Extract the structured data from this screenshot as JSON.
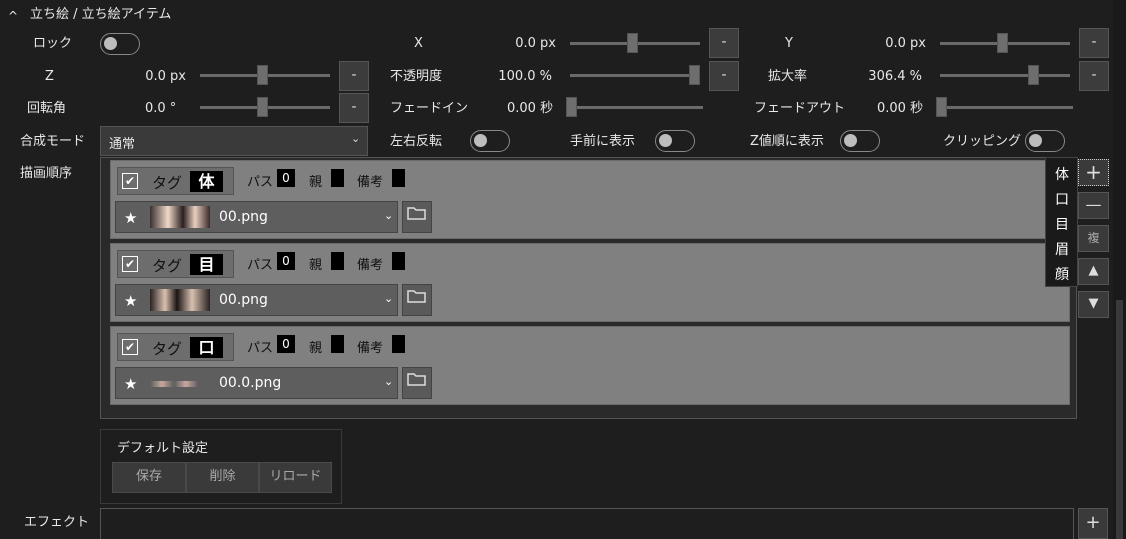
{
  "header": {
    "title": "立ち絵 / 立ち絵アイテム",
    "chevron": "^"
  },
  "row1": {
    "lock_label": "ロック",
    "x_label": "X",
    "x_value": "0.0 px",
    "x_level": 0.5,
    "y_label": "Y",
    "y_value": "0.0 px",
    "y_level": 0.5,
    "minus": "-"
  },
  "row2": {
    "z_label": "Z",
    "z_value": "0.0 px",
    "z_level": 0.5,
    "opacity_label": "不透明度",
    "opacity_value": "100.0 %",
    "opacity_level": 1.0,
    "scale_label": "拡大率",
    "scale_value": "306.4 %",
    "scale_level": 0.75,
    "minus": "-"
  },
  "row3": {
    "rotation_label": "回転角",
    "rotation_value": "0.0 °",
    "rotation_level": 0.5,
    "fadein_label": "フェードイン",
    "fadein_value": "0.00 秒",
    "fadeout_label": "フェードアウト",
    "fadeout_value": "0.00 秒",
    "minus": "-"
  },
  "row4": {
    "blend_label": "合成モード",
    "blend_value": "通常",
    "flip_label": "左右反転",
    "front_label": "手前に表示",
    "zorder_label": "Z値順に表示",
    "clip_label": "クリッピング"
  },
  "draw_order_label": "描画順序",
  "layers": [
    {
      "tag_label": "タグ",
      "tag": "体",
      "pass_label": "パス",
      "pass": "0",
      "parent_label": "親",
      "note_label": "備考",
      "file": "00.png"
    },
    {
      "tag_label": "タグ",
      "tag": "目",
      "pass_label": "パス",
      "pass": "0",
      "parent_label": "親",
      "note_label": "備考",
      "file": "00.png"
    },
    {
      "tag_label": "タグ",
      "tag": "口",
      "pass_label": "パス",
      "pass": "0",
      "parent_label": "親",
      "note_label": "備考",
      "file": "00.0.png"
    }
  ],
  "popup_items": [
    "体",
    "口",
    "目",
    "眉",
    "顔"
  ],
  "side_buttons": {
    "add": "+",
    "remove": "—",
    "copy": "複",
    "up": "▲",
    "down": "▼"
  },
  "default_settings": {
    "title": "デフォルト設定",
    "save": "保存",
    "delete": "削除",
    "reload": "リロード"
  },
  "effect": {
    "label": "エフェクト",
    "add": "+"
  },
  "icons": {
    "check": "✔",
    "star": "★",
    "chevron": "⌄",
    "folder": "folder-icon"
  }
}
